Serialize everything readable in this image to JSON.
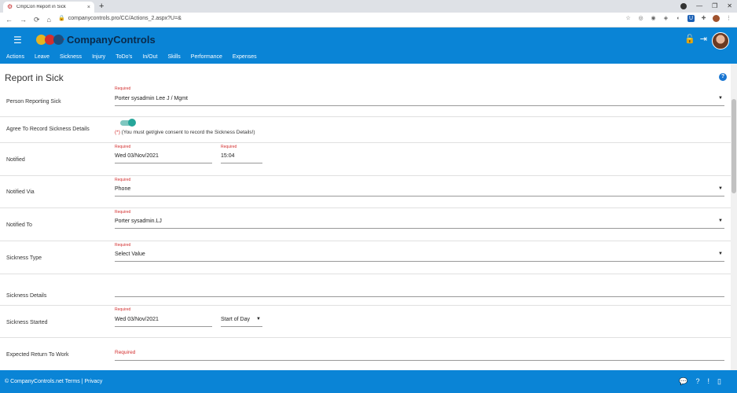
{
  "browser": {
    "tab_title": "CmpCon Report in Sick",
    "tab_close": "×",
    "new_tab": "+",
    "url": "companycontrols.pro/CC/Actions_2.aspx?U=&",
    "nav": {
      "back": "←",
      "forward": "→",
      "reload": "⟳",
      "home": "⌂"
    },
    "window": {
      "minimize": "—",
      "restore": "❐",
      "close": "✕"
    }
  },
  "app": {
    "brand": "CompanyControls",
    "menu": [
      "Actions",
      "Leave",
      "Sickness",
      "Injury",
      "ToDo's",
      "In/Out",
      "Skills",
      "Performance",
      "Expenses"
    ]
  },
  "page": {
    "title": "Report in Sick",
    "help": "?"
  },
  "form": {
    "required_text": "Required",
    "person": {
      "label": "Person Reporting Sick",
      "value": "Porter sysadmin Lee J / Mgmt"
    },
    "agree": {
      "label": "Agree To Record Sickness Details",
      "star": "(*)",
      "consent": " (You must get/give consent to record the Sickness Details!)"
    },
    "notified": {
      "label": "Notified",
      "date": "Wed 03/Nov/2021",
      "time": "15:04"
    },
    "notified_via": {
      "label": "Notified Via",
      "value": "Phone"
    },
    "notified_to": {
      "label": "Notified To",
      "value": "Porter sysadmin.LJ"
    },
    "sickness_type": {
      "label": "Sickness Type",
      "value": "Select Value"
    },
    "sickness_details": {
      "label": "Sickness Details",
      "value": ""
    },
    "sickness_started": {
      "label": "Sickness Started",
      "date": "Wed 03/Nov/2021",
      "period": "Start of Day"
    },
    "expected_return": {
      "label": "Expected Return To Work"
    }
  },
  "footer": {
    "copyright": "© CompanyControls.net",
    "terms": "Terms",
    "separator": "|",
    "privacy": "Privacy"
  },
  "colors": {
    "primary": "#0a84d6",
    "required": "#d32f2f",
    "toggle": "#26a69a"
  }
}
